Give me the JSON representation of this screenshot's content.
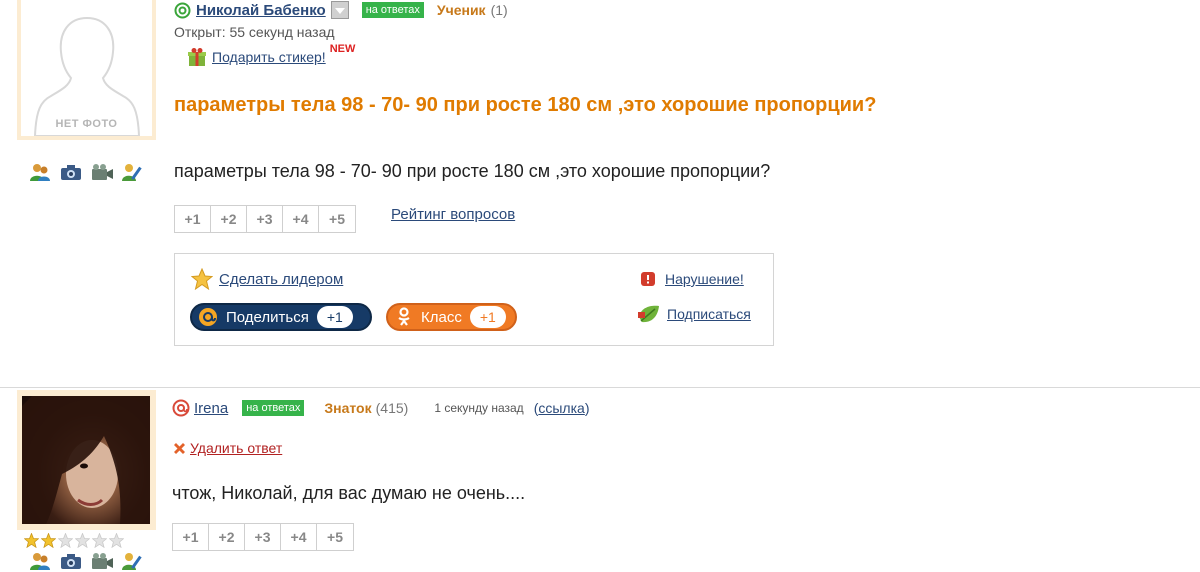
{
  "question": {
    "author": {
      "name": "Николай Бабенко",
      "badge": "на ответах",
      "rank": "Ученик",
      "points": "(1)",
      "avatar_text": "НЕТ ФОТО"
    },
    "opened": "Открыт: 55 секунд назад",
    "gift": {
      "label": "Подарить стикер!",
      "new_label": "NEW"
    },
    "title": "параметры тела 98 - 70- 90 при росте 180 см ,это хорошие пропорции?",
    "body": "параметры тела 98 - 70- 90 при росте 180 см ,это хорошие пропорции?",
    "rating_buttons": [
      "+1",
      "+2",
      "+3",
      "+4",
      "+5"
    ],
    "rating_link": "Рейтинг вопросов",
    "actions": {
      "make_leader": "Сделать лидером",
      "report": "Нарушение!",
      "subscribe": "Подписаться",
      "share": {
        "label": "Поделиться",
        "count": "+1",
        "color": "#163a66"
      },
      "klass": {
        "label": "Класс",
        "count": "+1",
        "color": "#f07a24"
      }
    }
  },
  "answer": {
    "author": {
      "name": "Irena",
      "badge": "на ответах",
      "rank": "Знаток",
      "points": "(415)"
    },
    "time": "1 секунду назад",
    "link_open": "(",
    "link_label": "ссылка",
    "link_close": ")",
    "delete_label": "Удалить ответ",
    "body": "чтож, Николай, для вас думаю не очень....",
    "rating_buttons": [
      "+1",
      "+2",
      "+3",
      "+4",
      "+5"
    ],
    "stars": {
      "filled": 2,
      "total": 6
    }
  },
  "colors": {
    "title_orange": "#e07b00",
    "link_blue": "#2b4a7a",
    "badge_green": "#36b34a",
    "rank_orange": "#c7791a"
  }
}
